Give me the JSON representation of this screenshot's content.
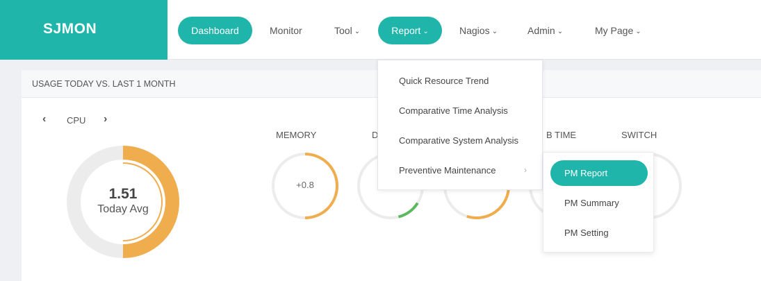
{
  "brand": "SJMON",
  "nav": [
    {
      "label": "Dashboard",
      "active": true,
      "chevron": ""
    },
    {
      "label": "Monitor",
      "active": false,
      "chevron": ""
    },
    {
      "label": "Tool",
      "active": false,
      "chevron": "⌄"
    },
    {
      "label": "Report",
      "active": true,
      "chevron": "⌄"
    },
    {
      "label": "Nagios",
      "active": false,
      "chevron": "⌄"
    },
    {
      "label": "Admin",
      "active": false,
      "chevron": "⌄"
    },
    {
      "label": "My Page",
      "active": false,
      "chevron": "⌄"
    }
  ],
  "panel": {
    "title": "USAGE TODAY VS. LAST 1 MONTH",
    "selector": {
      "prev": "‹",
      "label": "CPU",
      "next": "›"
    },
    "main_gauge": {
      "value": "1.51",
      "subtitle": "Today Avg",
      "level": 0.5
    },
    "gauges": [
      {
        "label": "MEMORY",
        "value": "+0.8",
        "color": "#f0ad4e",
        "level": 0.5
      },
      {
        "label": "D",
        "value": "",
        "color": "#5cb85c",
        "level": 0.12
      },
      {
        "label": "",
        "value": "",
        "color": "#f0ad4e",
        "level": 0.3
      },
      {
        "label": "B TIME",
        "value": "",
        "color": "#f0ad4e",
        "level": 0
      },
      {
        "label": "SWITCH",
        "value": "",
        "color": "#f0ad4e",
        "level": 0
      }
    ]
  },
  "report_menu": {
    "items": [
      "Quick Resource Trend",
      "Comparative Time Analysis",
      "Comparative System Analysis",
      "Preventive Maintenance"
    ],
    "submenu_arrow": "›"
  },
  "pm_submenu": {
    "items": [
      "PM Report",
      "PM Summary",
      "PM Setting"
    ]
  },
  "colors": {
    "accent": "#20b5aa",
    "orange": "#f0ad4e",
    "green": "#5cb85c",
    "track": "#ececec"
  }
}
